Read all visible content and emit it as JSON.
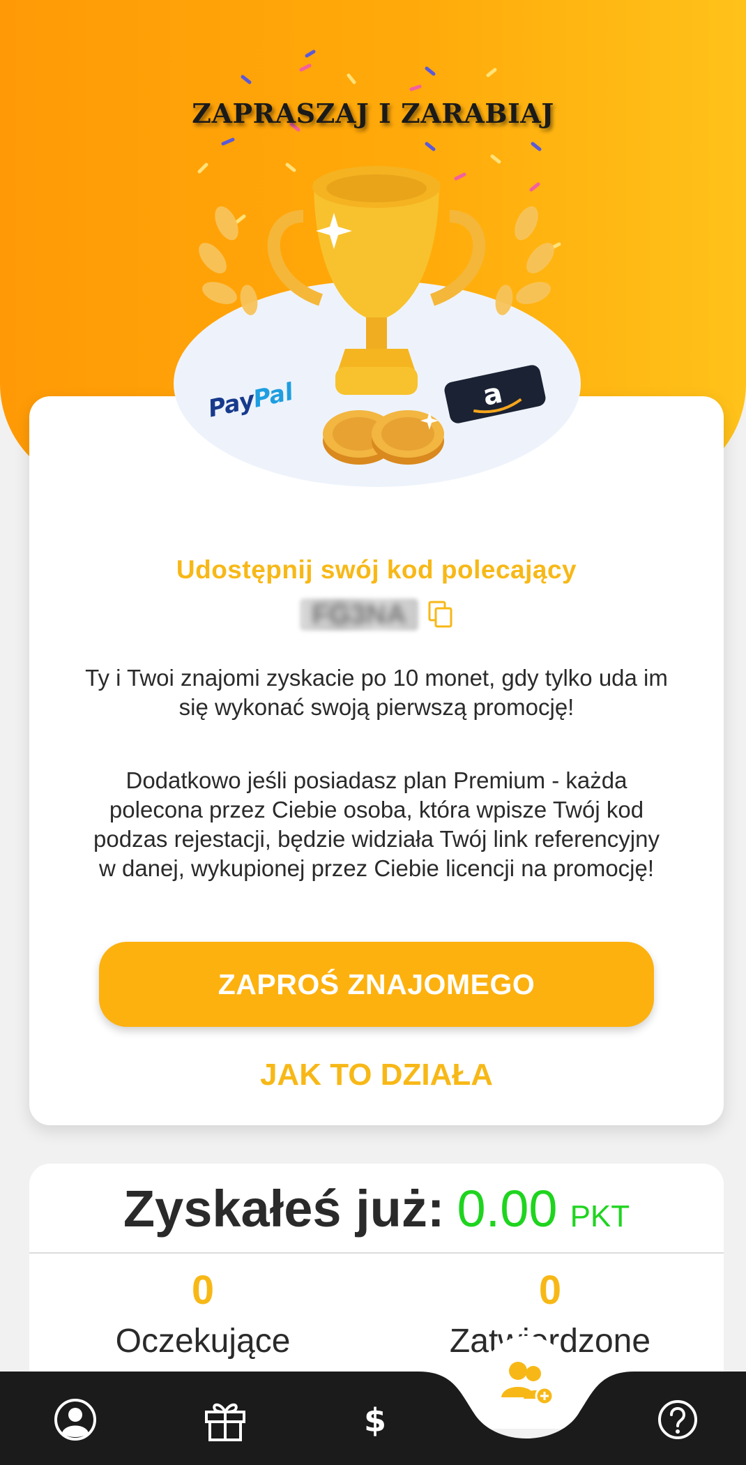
{
  "hero": {
    "title": "ZAPRASZAJ I ZARABIAJ",
    "logos": {
      "paypal": "PayPal",
      "amazon": "a"
    }
  },
  "referral": {
    "title": "Udostępnij swój kod polecający",
    "code": "FG3NA",
    "description_1": "Ty i Twoi znajomi zyskacie po 10 monet, gdy tylko uda im się wykonać swoją pierwszą promocję!",
    "description_2": "Dodatkowo jeśli posiadasz plan Premium - każda polecona przez Ciebie osoba, która wpisze Twój kod podzas rejestacji, będzie widziała Twój link referencyjny w danej, wykupionej przez Ciebie licencji na promocję!",
    "invite_button": "ZAPROŚ ZNAJOMEGO",
    "how_it_works": "JAK TO DZIAŁA"
  },
  "stats": {
    "label": "Zyskałeś już:",
    "value": "0.00",
    "unit": "PKT",
    "pending_count": "0",
    "pending_label": "Oczekujące",
    "confirmed_count": "0",
    "confirmed_label": "Zatwierdzone"
  },
  "nav": {
    "items": [
      "profile-icon",
      "gift-icon",
      "dollar-icon",
      "invite-friends-icon",
      "help-icon"
    ],
    "active": "invite-friends-icon"
  },
  "colors": {
    "accent": "#f7b817",
    "button": "#fdb10f",
    "success": "#1fd41f",
    "nav_bg": "#1b1b1b"
  }
}
